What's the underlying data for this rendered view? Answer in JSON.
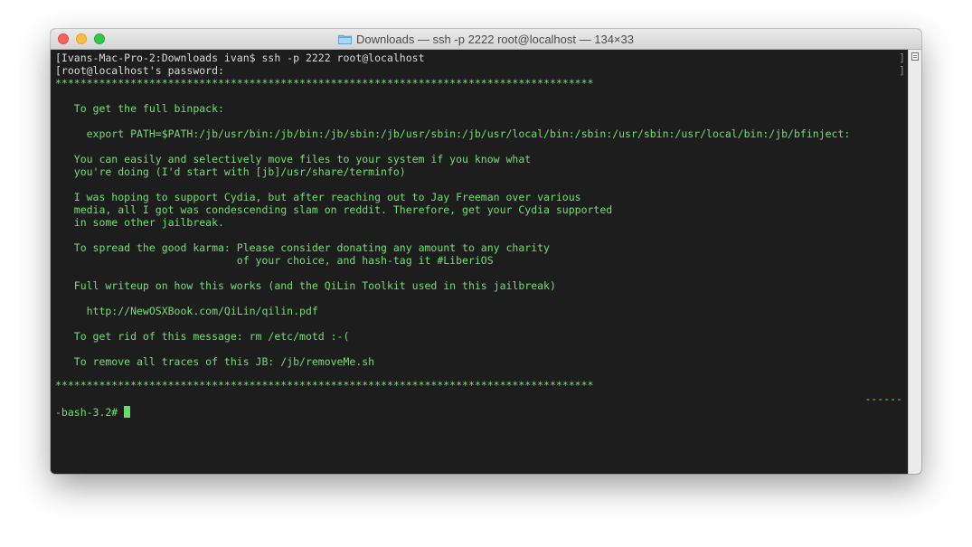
{
  "window": {
    "title": "Downloads — ssh -p 2222 root@localhost — 134×33",
    "folder_icon": "folder-icon"
  },
  "terminal": {
    "prompt_line": "[Ivans-Mac-Pro-2:Downloads ivan$ ssh -p 2222 root@localhost",
    "password_prompt": "[root@localhost's password:",
    "right_bracket": "]",
    "separator": "**************************************************************************************",
    "lines": [
      "   To get the full binpack:",
      "     export PATH=$PATH:/jb/usr/bin:/jb/bin:/jb/sbin:/jb/usr/sbin:/jb/usr/local/bin:/sbin:/usr/sbin:/usr/local/bin:/jb/bfinject:",
      "   You can easily and selectively move files to your system if you know what",
      "   you're doing (I'd start with [jb]/usr/share/terminfo)",
      "   I was hoping to support Cydia, but after reaching out to Jay Freeman over various",
      "   media, all I got was condescending slam on reddit. Therefore, get your Cydia supported",
      "   in some other jailbreak.",
      "   To spread the good karma: Please consider donating any amount to any charity",
      "                             of your choice, and hash-tag it #LiberiOS",
      "   Full writeup on how this works (and the QiLin Toolkit used in this jailbreak)",
      "     http://NewOSXBook.com/QiLin/qilin.pdf",
      "   To get rid of this message: rm /etc/motd :-(",
      "   To remove all traces of this JB: /jb/removeMe.sh"
    ],
    "trailing_dashes": "------",
    "shell_prompt": "-bash-3.2# "
  },
  "colors": {
    "terminal_bg": "#1d1d1d",
    "terminal_text": "#6fe06f",
    "cursor": "#62e062"
  }
}
